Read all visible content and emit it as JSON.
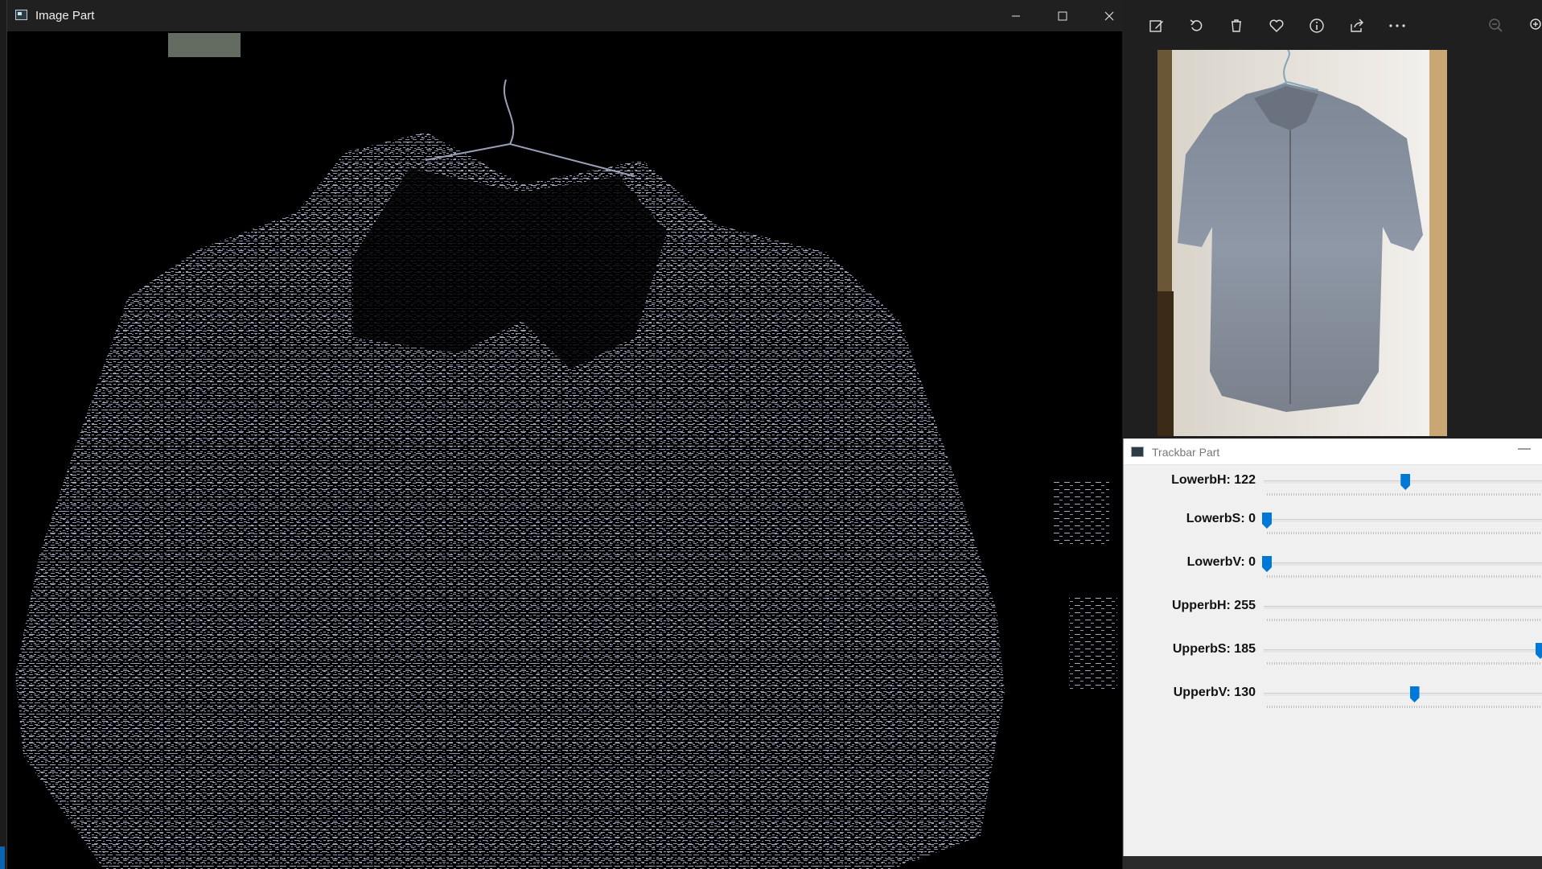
{
  "image_window": {
    "title": "Image Part",
    "buttons": {
      "minimize": "minimize-icon",
      "maximize": "maximize-icon",
      "close": "close-icon"
    }
  },
  "photos_viewer": {
    "toolbar": [
      {
        "icon": "edit-image-icon"
      },
      {
        "icon": "rotate-icon"
      },
      {
        "icon": "trash-icon"
      },
      {
        "icon": "heart-icon"
      },
      {
        "icon": "info-icon"
      },
      {
        "icon": "share-icon"
      },
      {
        "icon": "more-icon"
      },
      {
        "icon": "zoom-out-icon"
      },
      {
        "icon": "zoom-in-icon"
      }
    ],
    "image": "shirt-photo"
  },
  "trackbar_window": {
    "title": "Trackbar Part",
    "trackbars": [
      {
        "label": "LowerbH: 122",
        "value": 122,
        "max": 255
      },
      {
        "label": "LowerbS: 0",
        "value": 0,
        "max": 255
      },
      {
        "label": "LowerbV: 0",
        "value": 0,
        "max": 255
      },
      {
        "label": "UpperbH: 255",
        "value": 255,
        "max": 255
      },
      {
        "label": "UpperbS: 185",
        "value": 185,
        "max": 185
      },
      {
        "label": "UpperbV: 130",
        "value": 130,
        "max": 255
      }
    ]
  },
  "colors": {
    "titlebar_dark": "#202020",
    "accent": "#0078d7",
    "mask_shirt": "#8a90a8"
  }
}
